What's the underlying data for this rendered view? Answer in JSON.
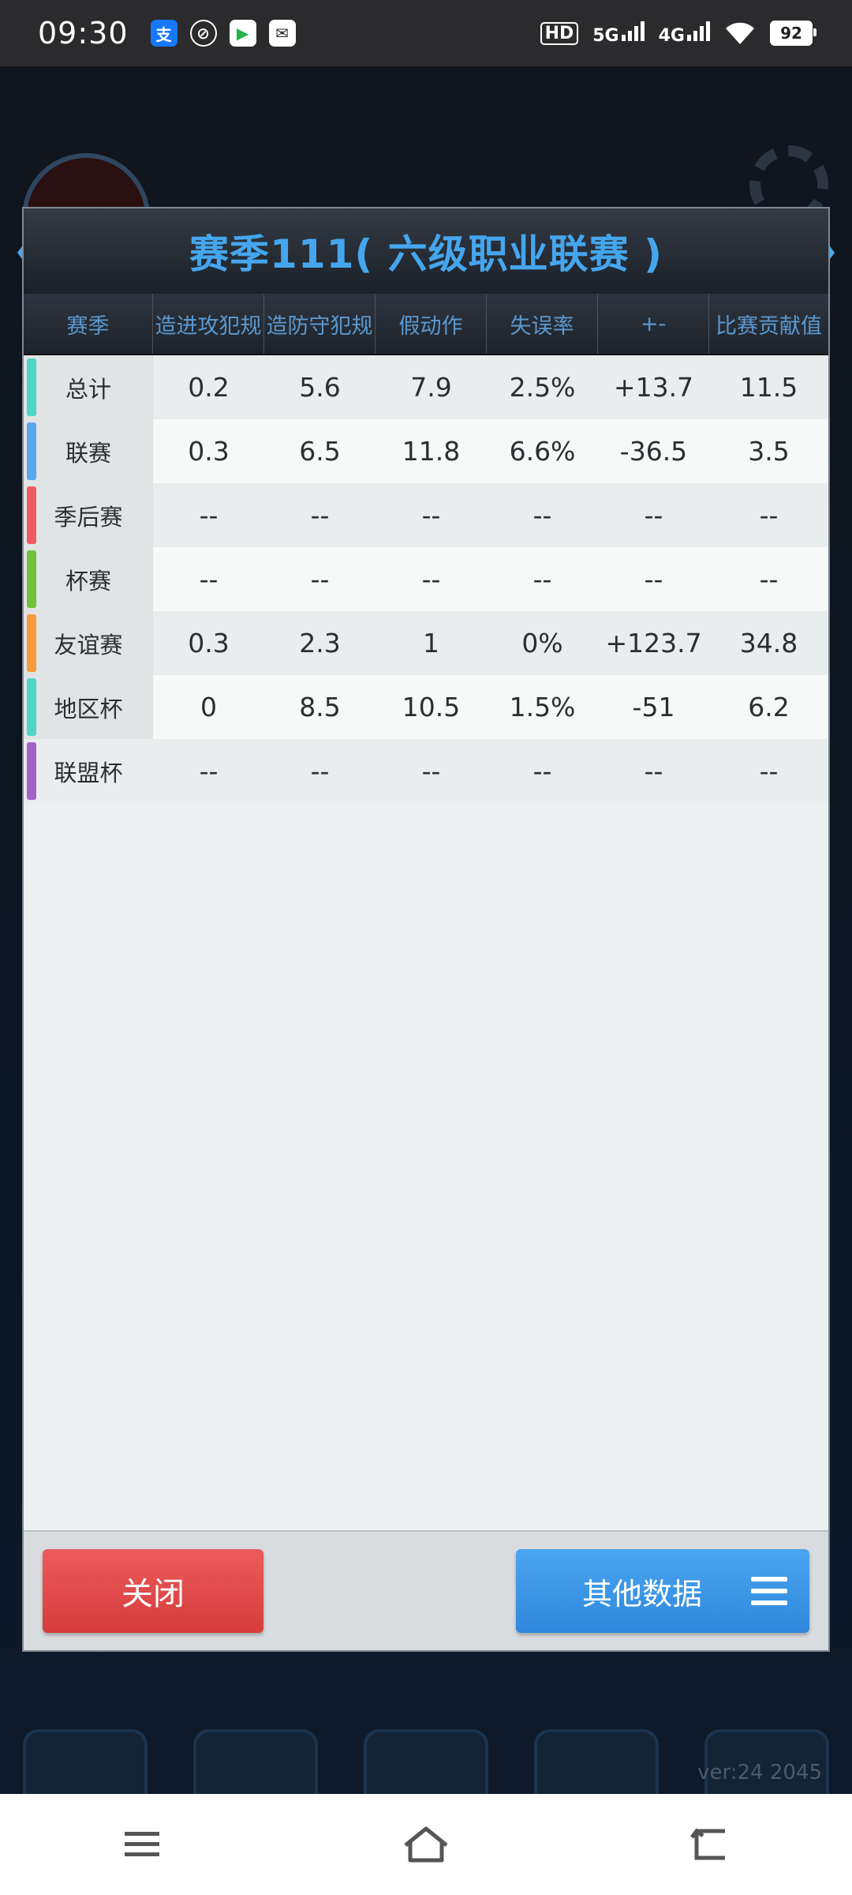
{
  "status_bar": {
    "time": "09:30",
    "apps": [
      {
        "icon": "alipay-icon",
        "glyph": "支",
        "bg": "#1677ff"
      },
      {
        "icon": "loop-app-icon",
        "glyph": "⊘",
        "bg": "#2b2b2d"
      },
      {
        "icon": "video-app-icon",
        "glyph": "▶",
        "bg": "#ffffff"
      },
      {
        "icon": "message-app-icon",
        "glyph": "✉",
        "bg": "#ffffff"
      }
    ],
    "hd_label": "HD",
    "net_5g": "5G",
    "net_4g": "4G",
    "battery": "92"
  },
  "dialog": {
    "title": "赛季111( 六级职业联赛 )",
    "columns": [
      "赛季",
      "造进攻犯规",
      "造防守犯规",
      "假动作",
      "失误率",
      "+-",
      "比赛贡献值"
    ],
    "rows": [
      {
        "name": "总计",
        "color": "#4fd6c6",
        "values": [
          "0.2",
          "5.6",
          "7.9",
          "2.5%",
          "+13.7",
          "11.5"
        ]
      },
      {
        "name": "联赛",
        "color": "#5aa6ef",
        "values": [
          "0.3",
          "6.5",
          "11.8",
          "6.6%",
          "-36.5",
          "3.5"
        ]
      },
      {
        "name": "季后赛",
        "color": "#ef5a60",
        "values": [
          "--",
          "--",
          "--",
          "--",
          "--",
          "--"
        ]
      },
      {
        "name": "杯赛",
        "color": "#6ec23b",
        "values": [
          "--",
          "--",
          "--",
          "--",
          "--",
          "--"
        ]
      },
      {
        "name": "友谊赛",
        "color": "#f59b3b",
        "values": [
          "0.3",
          "2.3",
          "1",
          "0%",
          "+123.7",
          "34.8"
        ]
      },
      {
        "name": "地区杯",
        "color": "#4fd6c6",
        "values": [
          "0",
          "8.5",
          "10.5",
          "1.5%",
          "-51",
          "6.2"
        ]
      },
      {
        "name": "联盟杯",
        "color": "#a262c8",
        "values": [
          "--",
          "--",
          "--",
          "--",
          "--",
          "--"
        ]
      }
    ],
    "close_label": "关闭",
    "other_label": "其他数据"
  },
  "background": {
    "version": "ver:24  2045"
  },
  "colors": {
    "accent": "#45a6ee",
    "close": "#e24b4b",
    "other": "#3b95e6"
  }
}
